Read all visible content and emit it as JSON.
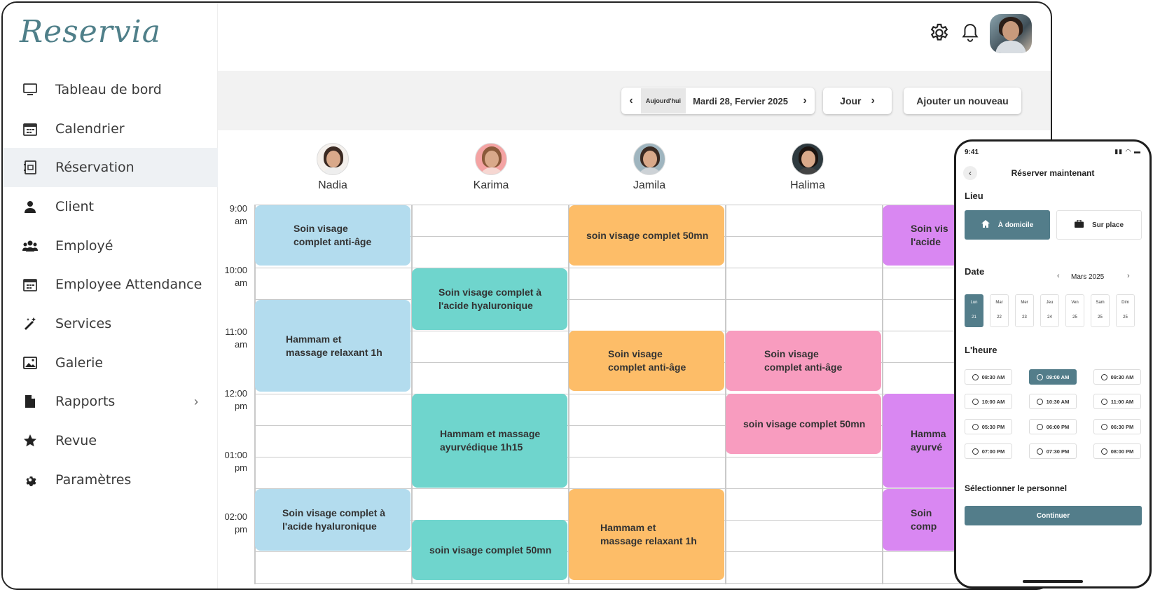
{
  "app": {
    "logo": "Reservia"
  },
  "sidebar": {
    "items": [
      {
        "label": "Tableau de bord",
        "icon": "monitor-icon"
      },
      {
        "label": "Calendrier",
        "icon": "calendar-icon"
      },
      {
        "label": "Réservation",
        "icon": "booking-icon"
      },
      {
        "label": "Client",
        "icon": "user-icon"
      },
      {
        "label": "Employé",
        "icon": "users-icon"
      },
      {
        "label": "Employee Attendance",
        "icon": "calendar-icon"
      },
      {
        "label": "Services",
        "icon": "magic-wand-icon"
      },
      {
        "label": "Galerie",
        "icon": "image-icon"
      },
      {
        "label": "Rapports",
        "icon": "file-icon"
      },
      {
        "label": "Revue",
        "icon": "star-icon"
      },
      {
        "label": "Paramètres",
        "icon": "gear-icon"
      }
    ],
    "active": "Réservation"
  },
  "header": {
    "icons": [
      "gear-icon",
      "bell-icon",
      "avatar"
    ]
  },
  "toolbar": {
    "today_label": "Aujourd'hui",
    "date": "Mardi 28, Fervier 2025",
    "view_label": "Jour",
    "add_label": "Ajouter un nouveau"
  },
  "staff": [
    {
      "name": "Nadia"
    },
    {
      "name": "Karima"
    },
    {
      "name": "Jamila"
    },
    {
      "name": "Halima"
    }
  ],
  "times": [
    {
      "hour": "9:00",
      "ampm": "am"
    },
    {
      "hour": "10:00",
      "ampm": "am"
    },
    {
      "hour": "11:00",
      "ampm": "am"
    },
    {
      "hour": "12:00",
      "ampm": "pm"
    },
    {
      "hour": "01:00",
      "ampm": "pm"
    },
    {
      "hour": "02:00",
      "ampm": "pm"
    }
  ],
  "events": {
    "nadia": [
      {
        "l1": "Soin visage",
        "l2": "complet anti-âge"
      },
      {
        "l1": "Hammam et",
        "l2": "massage relaxant 1h"
      },
      {
        "l1": "Soin visage complet à",
        "l2": "l'acide hyaluronique"
      }
    ],
    "karima": [
      {
        "l1": "Soin visage complet à",
        "l2": "l'acide hyaluronique"
      },
      {
        "l1": "Hammam et massage",
        "l2": "ayurvédique 1h15"
      },
      {
        "l1": "soin visage complet 50mn",
        "l2": ""
      }
    ],
    "jamila": [
      {
        "l1": "soin visage complet 50mn",
        "l2": ""
      },
      {
        "l1": "Soin visage",
        "l2": "complet anti-âge"
      },
      {
        "l1": "Hammam et",
        "l2": "massage relaxant 1h"
      }
    ],
    "halima": [
      {
        "l1": "Soin visage",
        "l2": "complet anti-âge"
      },
      {
        "l1": "soin visage complet 50mn",
        "l2": ""
      }
    ],
    "fifth": [
      {
        "l1": "Soin vis",
        "l2": "l'acide"
      },
      {
        "l1": "Hamma",
        "l2": "ayurvé"
      },
      {
        "l1": "Soin",
        "l2": "comp"
      }
    ]
  },
  "phone": {
    "time": "9:41",
    "title": "Réserver maintenant",
    "lieu_label": "Lieu",
    "loc_home": "À domicile",
    "loc_place": "Sur place",
    "date_label": "Date",
    "month": "Mars 2025",
    "days": [
      {
        "d": "Lun",
        "n": "21"
      },
      {
        "d": "Mar",
        "n": "22"
      },
      {
        "d": "Mer",
        "n": "23"
      },
      {
        "d": "Jeu",
        "n": "24"
      },
      {
        "d": "Ven",
        "n": "25"
      },
      {
        "d": "Sam",
        "n": "25"
      },
      {
        "d": "Dim",
        "n": "25"
      }
    ],
    "hour_label": "L'heure",
    "slots": [
      "08:30 AM",
      "09:00 AM",
      "09:30 AM",
      "10:00 AM",
      "10:30 AM",
      "11:00 AM",
      "05:30 PM",
      "06:00 PM",
      "06:30 PM",
      "07:00 PM",
      "07:30 PM",
      "08:00 PM"
    ],
    "selected_slot": "09:00 AM",
    "staff_label": "Sélectionner le personnel",
    "continue_label": "Continuer"
  },
  "colors": {
    "accent": "#537d8a",
    "blue": "#b3dcee",
    "teal": "#6fd5cd",
    "orange": "#fdbd68",
    "pink": "#f89cbf",
    "purple": "#d987f2"
  }
}
